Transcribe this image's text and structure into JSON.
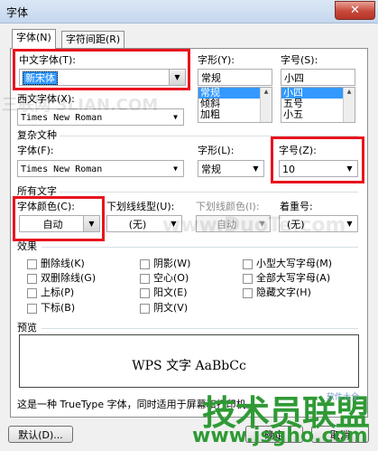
{
  "window": {
    "title": "字体",
    "close_glyph": "✕"
  },
  "tabs": [
    {
      "label": "字体(N)"
    },
    {
      "label": "字符间距(R)"
    }
  ],
  "chinese_font": {
    "label": "中文字体(T):",
    "value": "新宋体"
  },
  "font_style": {
    "label": "字形(Y):",
    "value": "常规",
    "options": [
      "常规",
      "倾斜",
      "加粗"
    ],
    "selected": "常规"
  },
  "font_size": {
    "label": "字号(S):",
    "value": "小四",
    "options": [
      "小四",
      "五号",
      "小五"
    ],
    "selected": "小四"
  },
  "western_font": {
    "label": "西文字体(X):",
    "value": "Times New Roman"
  },
  "complex": {
    "section": "复杂文种",
    "font_label": "字体(F):",
    "font_value": "Times New Roman",
    "style_label": "字形(L):",
    "style_value": "常规",
    "size_label": "字号(Z):",
    "size_value": "10"
  },
  "all_text": {
    "section": "所有文字",
    "font_color_label": "字体颜色(C):",
    "font_color_value": "自动",
    "underline_type_label": "下划线线型(U):",
    "underline_type_value": "(无)",
    "underline_color_label": "下划线颜色(I):",
    "underline_color_value": "自动",
    "emphasis_label": "着重号:",
    "emphasis_value": "(无)"
  },
  "effects": {
    "section": "效果",
    "col1": [
      "删除线(K)",
      "双删除线(G)",
      "上标(P)",
      "下标(B)"
    ],
    "col2": [
      "阴影(W)",
      "空心(O)",
      "阳文(E)",
      "阴文(V)"
    ],
    "col3": [
      "小型大写字母(M)",
      "全部大写字母(A)",
      "隐藏文字(H)"
    ]
  },
  "preview": {
    "section": "预览",
    "sample": "WPS 文字 AaBbCc",
    "note": "这是一种 TrueType 字体，同时适用于屏幕和打印机。"
  },
  "buttons": {
    "default_label": "默认(D)...",
    "ok_label": "确定",
    "cancel_label": "取消"
  },
  "watermarks": {
    "w1": "三联网 3LIAN.COM",
    "w2": "www.DuoTe.com",
    "w3": "技术员联盟",
    "w4": "www.jsgho.com",
    "w5": "软件大全"
  },
  "colors": {
    "highlight": "#e8141e",
    "selection": "#3399ff",
    "watermark_green": "#2f9a35"
  }
}
